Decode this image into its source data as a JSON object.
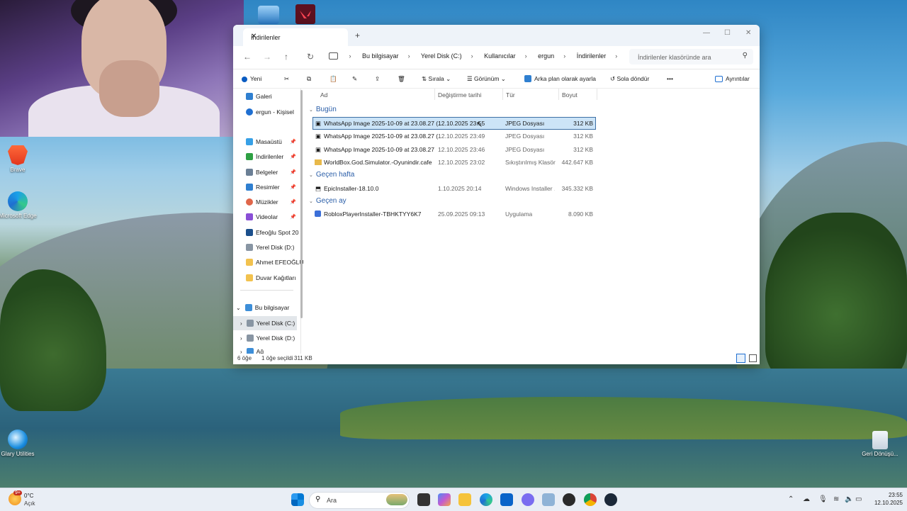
{
  "explorer": {
    "tab_title": "İndirilenler",
    "tab_close": "✕",
    "new_tab": "+",
    "window_controls": {
      "minimize": "—",
      "maximize": "☐",
      "close": "✕"
    },
    "nav": {
      "back": "←",
      "forward": "→",
      "up": "↑",
      "refresh": "↻"
    },
    "breadcrumb": [
      "Bu bilgisayar",
      "Yerel Disk (C:)",
      "Kullanıcılar",
      "ergun",
      "İndirilenler"
    ],
    "breadcrumb_sep": "›",
    "search_placeholder": "İndirilenler klasöründe ara",
    "toolbar": {
      "new": "Yeni",
      "sort": "Sırala",
      "view": "Görünüm",
      "set_background": "Arka plan olarak ayarla",
      "rotate_left": "Sola döndür",
      "more": "•••",
      "details": "Ayrıntılar"
    },
    "sidebar": {
      "items": [
        {
          "label": "Galeri",
          "pinned": false
        },
        {
          "label": "ergun - Kişisel",
          "pinned": false
        },
        {
          "label": "Masaüstü",
          "pinned": true
        },
        {
          "label": "İndirilenler",
          "pinned": true
        },
        {
          "label": "Belgeler",
          "pinned": true
        },
        {
          "label": "Resimler",
          "pinned": true
        },
        {
          "label": "Müzikler",
          "pinned": true
        },
        {
          "label": "Videolar",
          "pinned": true
        },
        {
          "label": "Efeoğlu Spot 20",
          "pinned": false
        },
        {
          "label": "Yerel Disk (D:)",
          "pinned": false
        },
        {
          "label": "Ahmet EFEOĞLU",
          "pinned": false
        },
        {
          "label": "Duvar Kağıtları",
          "pinned": false
        },
        {
          "label": "Bu bilgisayar",
          "pinned": false
        },
        {
          "label": "Yerel Disk (C:)",
          "pinned": false
        },
        {
          "label": "Yerel Disk (D:)",
          "pinned": false
        },
        {
          "label": "Ağ",
          "pinned": false
        }
      ],
      "pin_glyph": "📌"
    },
    "columns": {
      "name": "Ad",
      "modified": "Değiştirme tarihi",
      "type": "Tür",
      "size": "Boyut"
    },
    "groups": [
      {
        "label": "Bugün",
        "files": [
          {
            "name": "WhatsApp Image 2025-10-09 at 23.08.27 (...",
            "modified": "12.10.2025 23:55",
            "type": "JPEG Dosyası",
            "size": "312 KB",
            "selected": true
          },
          {
            "name": "WhatsApp Image 2025-10-09 at 23.08.27 (...",
            "modified": "12.10.2025 23:49",
            "type": "JPEG Dosyası",
            "size": "312 KB",
            "selected": false
          },
          {
            "name": "WhatsApp Image 2025-10-09 at 23.08.27",
            "modified": "12.10.2025 23:46",
            "type": "JPEG Dosyası",
            "size": "312 KB",
            "selected": false
          },
          {
            "name": "WorldBox.God.Simulator.-Oyunindir.cafe",
            "modified": "12.10.2025 23:02",
            "type": "Sıkıştırılmış Klasör",
            "size": "442.647 KB",
            "selected": false
          }
        ]
      },
      {
        "label": "Geçen hafta",
        "files": [
          {
            "name": "EpicInstaller-18.10.0",
            "modified": "1.10.2025 20:14",
            "type": "Windows Installer ...",
            "size": "345.332 KB",
            "selected": false
          }
        ]
      },
      {
        "label": "Geçen ay",
        "files": [
          {
            "name": "RobloxPlayerInstaller-TBHKTYY6K7",
            "modified": "25.09.2025 09:13",
            "type": "Uygulama",
            "size": "8.090 KB",
            "selected": false
          }
        ]
      }
    ],
    "status": {
      "count": "6 öğe",
      "selected": "1 öğe seçildi",
      "selected_size": "311 KB"
    }
  },
  "desktop": {
    "icons": [
      "Brave",
      "Microsoft Edge",
      "Glary Utilities",
      "Geri Dönüşü..."
    ]
  },
  "taskbar": {
    "weather_temp": "0°C",
    "weather_desc": "Açık",
    "weather_badge": "9+",
    "search_placeholder": "Ara",
    "time": "23:55",
    "date": "12.10.2025"
  },
  "colors": {
    "accent": "#0067c0",
    "selection": "#cce4f7",
    "group_text": "#2a5ea8"
  }
}
